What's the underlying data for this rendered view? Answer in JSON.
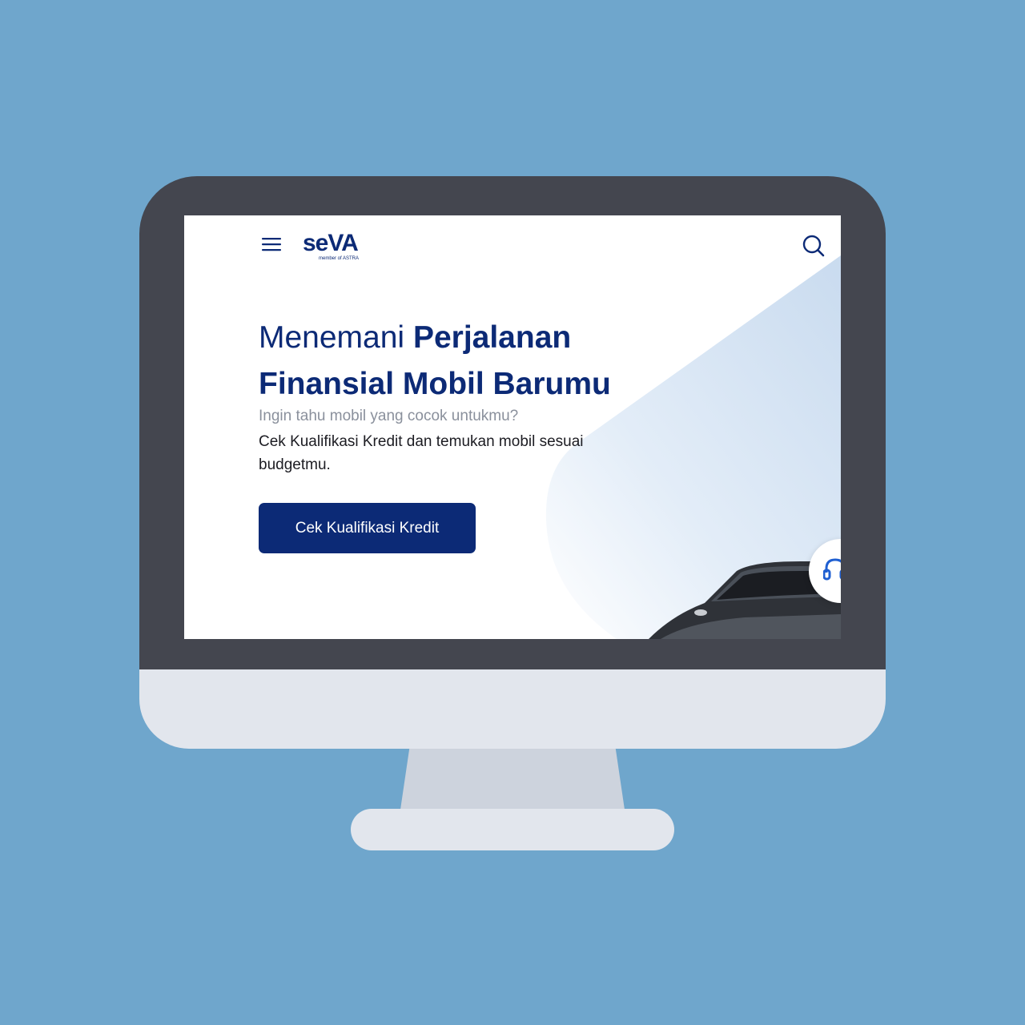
{
  "header": {
    "logo_text": "seVA",
    "logo_subtext": "member of ASTRA",
    "menu_icon": "hamburger-menu-icon",
    "search_icon": "search-icon"
  },
  "hero": {
    "headline_light": "Menemani ",
    "headline_bold_1": "Perjalanan",
    "headline_bold_2": "Finansial Mobil Barumu",
    "subtitle_question": "Ingin tahu mobil yang cocok untukmu?",
    "subtitle_body": "Cek Kualifikasi Kredit dan temukan mobil sesuai budgetmu.",
    "cta_label": "Cek Kualifikasi Kredit"
  },
  "floating": {
    "support_icon": "headset-icon"
  },
  "colors": {
    "brand_navy": "#0c2a76",
    "accent_red": "#e53935",
    "background": "#6fa6cc",
    "bezel": "#44464f",
    "stand": "#e2e6ed"
  }
}
